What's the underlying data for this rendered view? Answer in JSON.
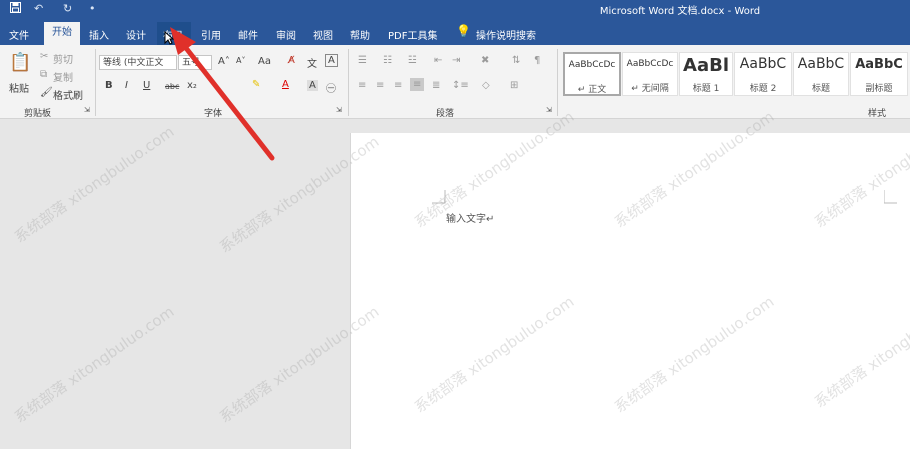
{
  "window": {
    "title": "Microsoft Word 文档.docx  -  Word"
  },
  "quick_access": {
    "save_icon": "save-icon",
    "undo_icon": "undo-icon",
    "redo_icon": "redo-icon",
    "more": "•"
  },
  "tabs": [
    "文件",
    "开始",
    "插入",
    "设计",
    "布局",
    "引用",
    "邮件",
    "审阅",
    "视图",
    "帮助",
    "PDF工具集"
  ],
  "tell_me": "操作说明搜索",
  "clipboard": {
    "paste": "粘贴",
    "cut": "剪切",
    "copy": "复制",
    "format_painter": "格式刷",
    "group_label": "剪贴板"
  },
  "font": {
    "name": "等线 (中文正文",
    "size": "五号",
    "aa_label": "Aa",
    "group_label": "字体",
    "bold": "B",
    "italic": "I",
    "underline": "U",
    "strike": "abc",
    "sub": "x₂",
    "font_color": "A"
  },
  "paragraph": {
    "group_label": "段落"
  },
  "styles": {
    "group_label": "样式",
    "items": [
      {
        "sample": "AaBbCcDc",
        "name": "↵ 正文"
      },
      {
        "sample": "AaBbCcDc",
        "name": "↵ 无间隔"
      },
      {
        "sample": "AaBl",
        "name": "标题 1"
      },
      {
        "sample": "AaBbC",
        "name": "标题 2"
      },
      {
        "sample": "AaBbC",
        "name": "标题"
      },
      {
        "sample": "AaBbC",
        "name": "副标题"
      }
    ]
  },
  "document": {
    "text": "输入文字↵"
  },
  "watermark": "系统部落 xitongbuluo.com",
  "colors": {
    "ribbon_blue": "#2b579a",
    "arrow_red": "#e0302a"
  }
}
